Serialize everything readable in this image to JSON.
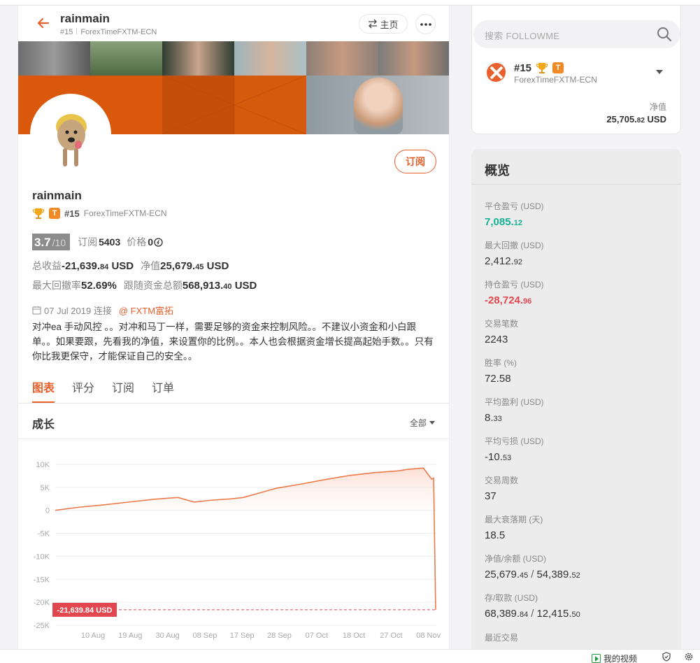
{
  "header": {
    "title": "rainmain",
    "rank": "#15",
    "broker": "ForexTimeFXTM-ECN",
    "home_label": "主页"
  },
  "profile": {
    "name": "rainmain",
    "rank": "#15",
    "broker": "ForexTimeFXTM-ECN",
    "subscribe_label": "订阅",
    "t_badge": "T",
    "score": "3.7",
    "score_of": "/10",
    "subs_label": "订阅",
    "subs_value": "5403",
    "price_label": "价格",
    "price_value": "0",
    "total_profit_label": "总收益",
    "total_profit_main": "-21,639.",
    "total_profit_dec": "84",
    "total_profit_unit": "USD",
    "equity_label": "净值",
    "equity_main": "25,679.",
    "equity_dec": "45",
    "equity_unit": "USD",
    "max_dd_label": "最大回撤率",
    "max_dd_value": "52.69%",
    "follow_funds_label": "跟随资金总额",
    "follow_funds_main": "568,913.",
    "follow_funds_dec": "40",
    "follow_funds_unit": "USD",
    "date": "07 Jul 2019 连接",
    "broker_link": "@ FXTM富拓",
    "description": "对冲ea 手动风控 。。对冲和马丁一样，需要足够的资金来控制风险。。不建议小资金和小白跟单。。如果要跟，先看我的净值，来设置你的比例。。本人也会根据资金增长提高起始手数。。只有你比我更保守，才能保证自己的安全。。"
  },
  "tabs": [
    {
      "label": "图表",
      "active": true
    },
    {
      "label": "评分",
      "active": false
    },
    {
      "label": "订阅",
      "active": false
    },
    {
      "label": "订单",
      "active": false
    }
  ],
  "growth": {
    "title": "成长",
    "range": "全部"
  },
  "chart_data": {
    "type": "area",
    "title": "成长",
    "yticks": [
      "10K",
      "5K",
      "0",
      "-5K",
      "-10K",
      "-15K",
      "-20K",
      "-25K"
    ],
    "ylim": [
      -25000,
      10000
    ],
    "xticks": [
      "10 Aug",
      "19 Aug",
      "30 Aug",
      "08 Sep",
      "17 Sep",
      "28 Sep",
      "07 Oct",
      "18 Oct",
      "27 Oct",
      "08 Nov"
    ],
    "grid": true,
    "last_value_label": "-21,639.84 USD",
    "last_value": -21639.84,
    "series": [
      {
        "x": [
          0,
          0.6,
          1.2,
          1.8,
          2.4,
          3.0,
          3.4,
          3.8,
          4.3,
          4.6,
          5.0,
          5.4,
          6.0,
          6.6,
          7.2,
          7.8,
          8.4,
          8.6,
          9.0,
          9.2,
          9.25,
          9.3
        ],
        "values": [
          0,
          700,
          1200,
          1800,
          2400,
          2800,
          1800,
          2200,
          2500,
          2800,
          3800,
          4800,
          5700,
          6700,
          7600,
          8200,
          8600,
          8900,
          9200,
          6800,
          7000,
          -21639.84
        ]
      }
    ]
  },
  "account": {
    "search_placeholder": "搜索 FOLLOWME",
    "rank": "#15",
    "t_badge": "T",
    "broker": "ForexTimeFXTM-ECN",
    "equity_label": "净值",
    "equity_main": "25,705.",
    "equity_dec": "82",
    "equity_unit": "USD"
  },
  "overview": {
    "title": "概览",
    "items": [
      {
        "label": "平仓盈亏 (USD)",
        "main": "7,085.",
        "dec": "12",
        "tone": "pos"
      },
      {
        "label": "最大回撤 (USD)",
        "main": "2,412.",
        "dec": "92",
        "tone": ""
      },
      {
        "label": "持仓盈亏 (USD)",
        "main": "-28,724.",
        "dec": "96",
        "tone": "neg"
      },
      {
        "label": "交易笔数",
        "main": "2243",
        "dec": "",
        "tone": ""
      },
      {
        "label": "胜率 (%)",
        "main": "72.58",
        "dec": "",
        "tone": ""
      },
      {
        "label": "平均盈利 (USD)",
        "main": "8.",
        "dec": "33",
        "tone": ""
      },
      {
        "label": "平均亏损 (USD)",
        "main": "-10.",
        "dec": "53",
        "tone": ""
      },
      {
        "label": "交易周数",
        "main": "37",
        "dec": "",
        "tone": ""
      },
      {
        "label": "最大衰落期 (天)",
        "main": "18.5",
        "dec": "",
        "tone": ""
      }
    ],
    "pair1": {
      "label": "净值/余额 (USD)",
      "a_main": "25,679.",
      "a_dec": "45",
      "b_main": "54,389.",
      "b_dec": "52"
    },
    "pair2": {
      "label": "存/取款 (USD)",
      "a_main": "68,389.",
      "a_dec": "84",
      "b_main": "12,415.",
      "b_dec": "50"
    },
    "recent_label": "最近交易"
  },
  "taskbar": {
    "video_label": "我的视频"
  },
  "colors": {
    "accent": "#e8612c",
    "positive": "#16b294",
    "negative": "#e2474f"
  }
}
